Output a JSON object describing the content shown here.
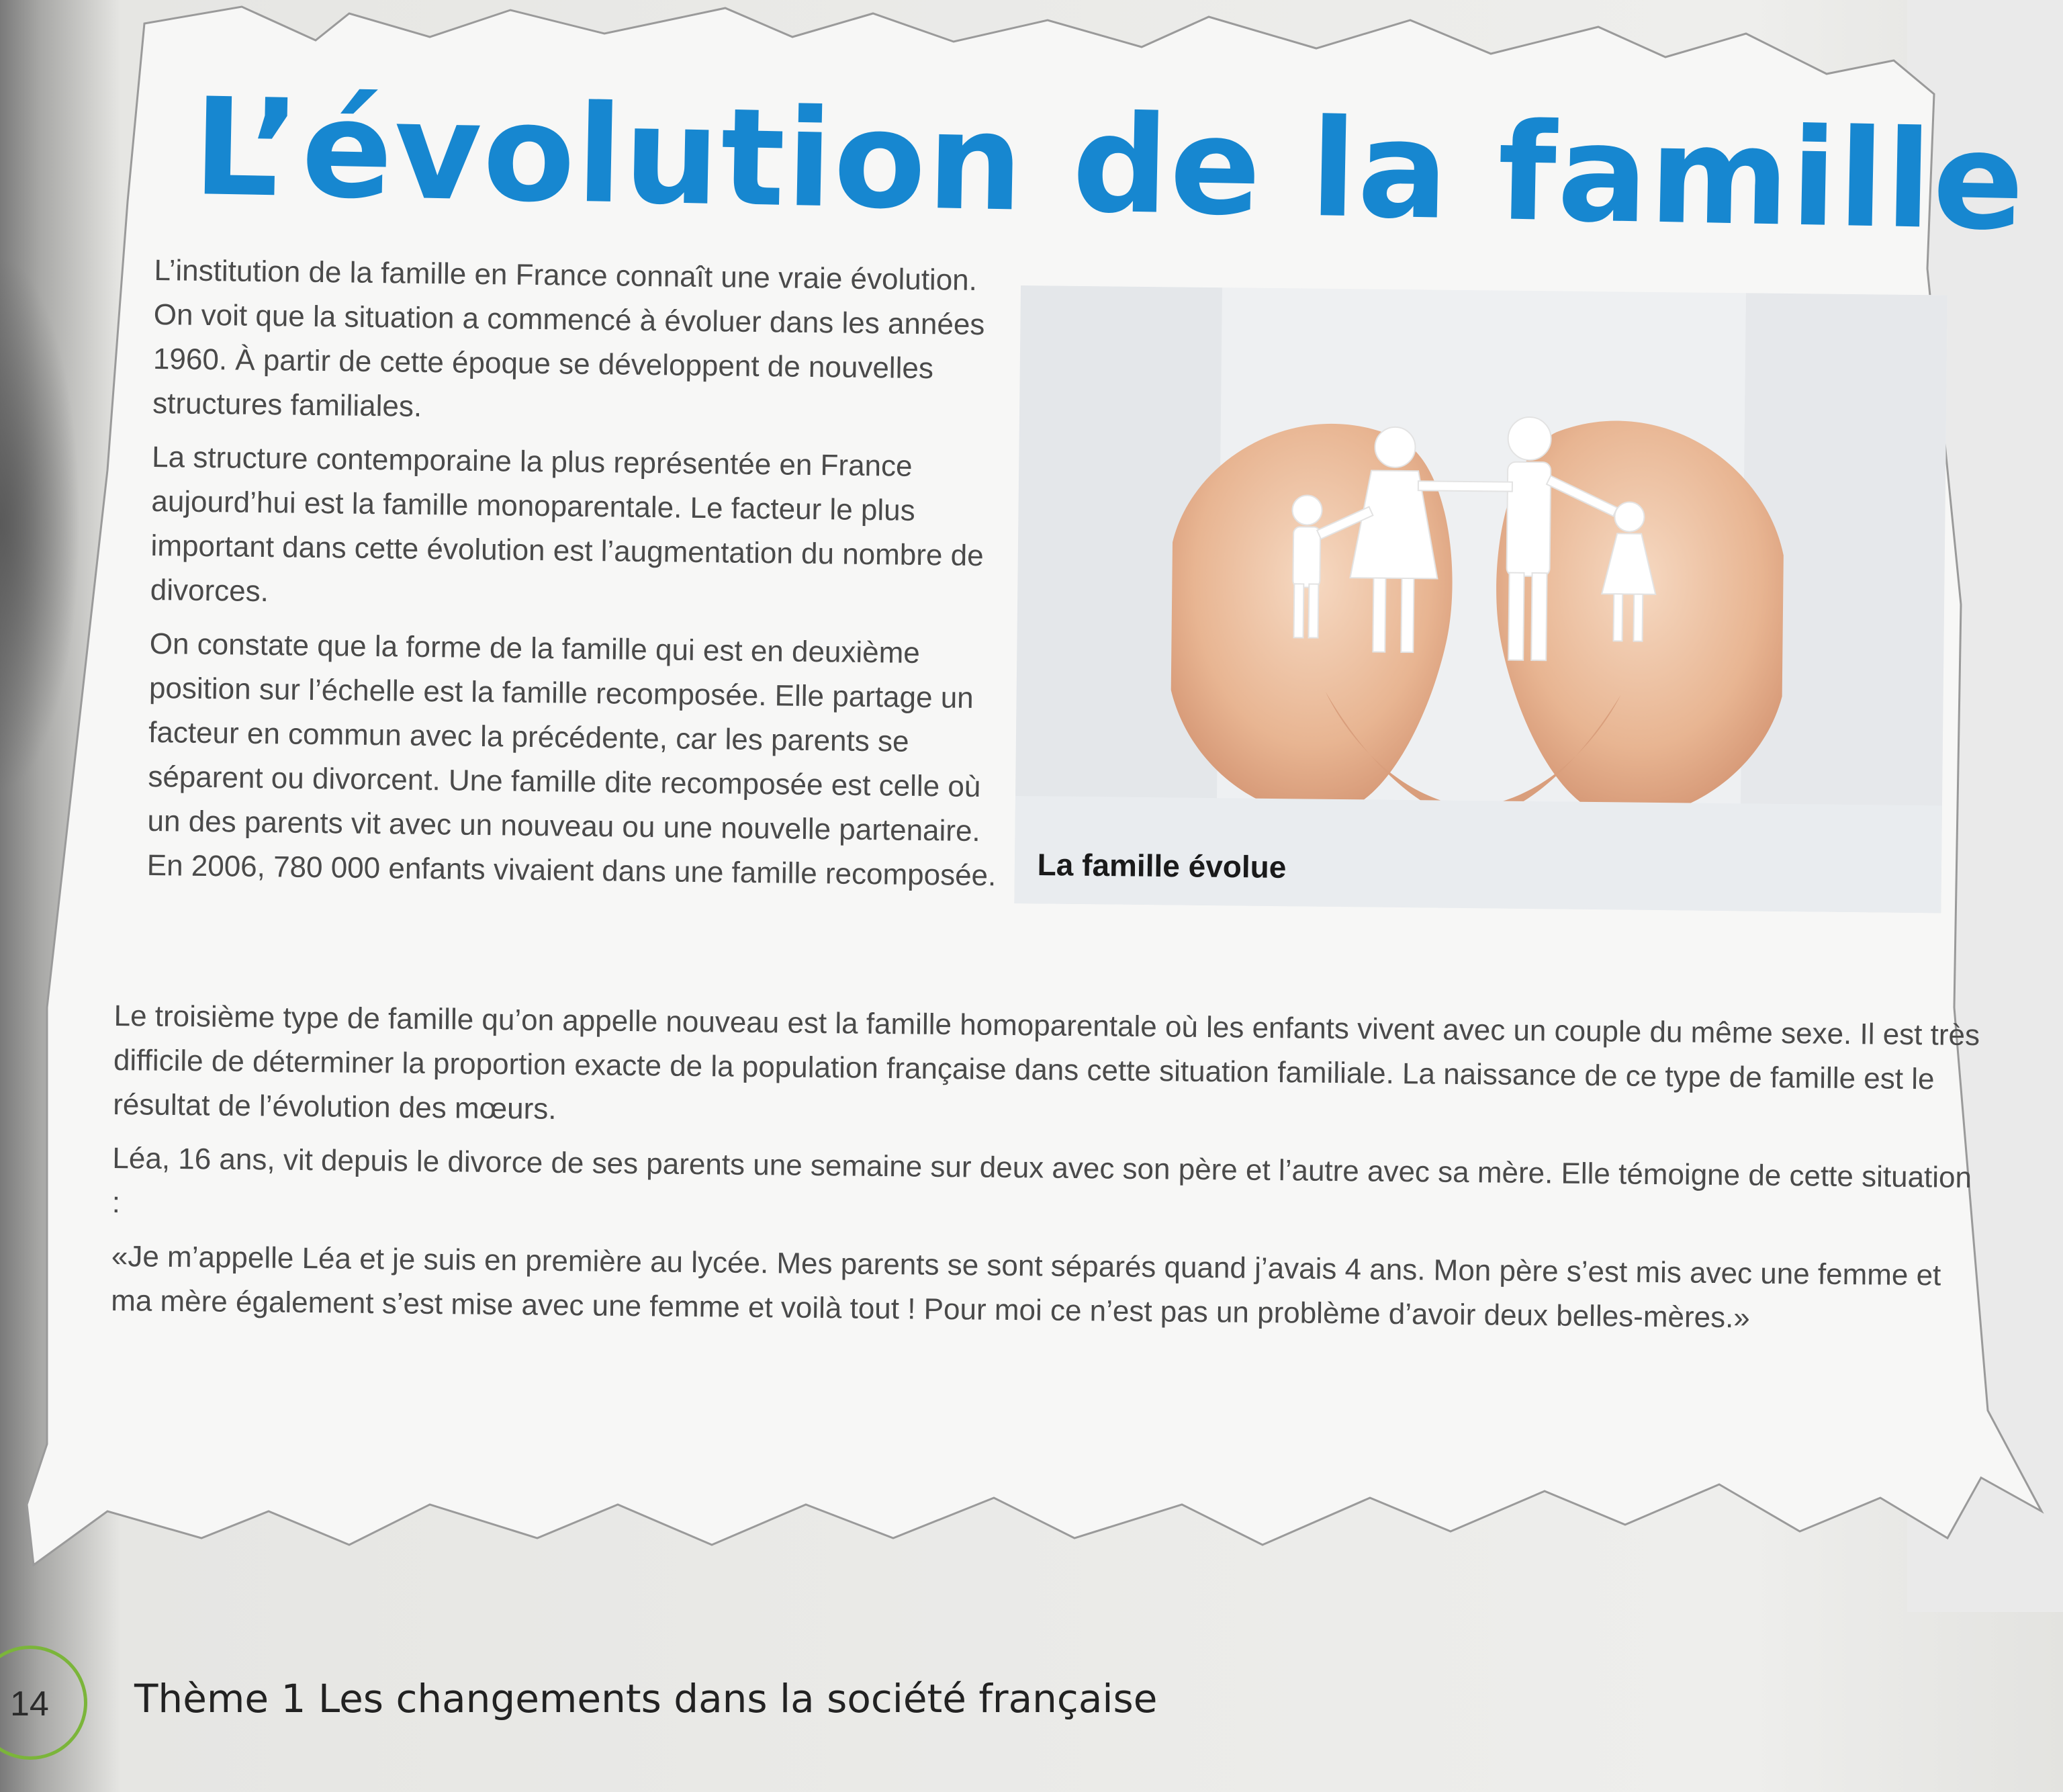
{
  "article": {
    "title": "L’évolution de la famille",
    "paragraphs_left": [
      "L’institution de la famille en France connaît une vraie évolution. On voit que la situation a commencé à évoluer dans les années 1960. À partir de cette époque se développent de nouvelles structures familiales.",
      "La structure contemporaine la plus représentée en France aujourd’hui est la famille monoparentale. Le facteur le plus important dans cette évolution est l’augmentation du nombre de divorces.",
      "On constate que la forme de la famille qui est en deuxième position sur l’échelle est la famille recomposée. Elle partage un facteur en commun avec la précédente, car les parents se séparent ou divorcent. Une famille dite recomposée est celle où un des parents vit avec un nouveau ou une nouvelle partenaire. En 2006, 780 000 enfants vivaient dans une famille recomposée."
    ],
    "paragraphs_full": [
      "Le troisième type de famille qu’on appelle nouveau est la famille homoparentale où les enfants vivent avec un couple du même sexe. Il est très difficile de déterminer la proportion exacte de la population française dans cette situation familiale. La naissance de ce type de famille est le résultat de l’évolution des mœurs.",
      "Léa, 16 ans, vit depuis le divorce de ses parents une semaine sur deux avec son père et l’autre avec sa mère. Elle témoigne de cette situation :",
      "«Je m’appelle Léa et je suis en première au lycée. Mes parents se sont séparés quand j’avais 4 ans. Mon père s’est mis avec une femme et ma mère également s’est mise avec une femme et voilà tout ! Pour moi ce n’est pas un problème d’avoir deux belles-mères.»"
    ],
    "photo_caption": "La famille évolue"
  },
  "footer": {
    "page_number": "14",
    "theme_title": "Thème 1  Les changements dans la société française"
  },
  "colors": {
    "title": "#1787d0",
    "page_circle": "#7bb53a",
    "body_text": "#4a4a4a"
  }
}
